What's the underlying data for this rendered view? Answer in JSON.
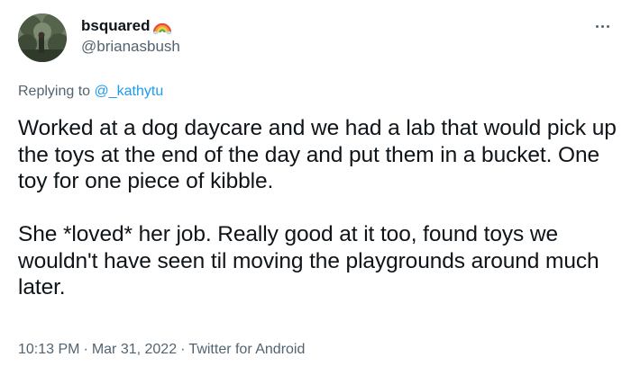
{
  "author": {
    "display_name": "bsquared",
    "handle": "@brianasbush",
    "name_emoji_icon": "rainbow-icon"
  },
  "more_icon": "more-horizontal-icon",
  "reply": {
    "prefix": "Replying to",
    "target": "@_kathytu"
  },
  "tweet": {
    "text": "Worked at a dog daycare and we had a lab that would pick up the toys at the end of the day and put them in a bucket. One toy for one piece of kibble.\n\nShe *loved* her job. Really good at it too, found toys we wouldn't have seen til moving the playgrounds around much later."
  },
  "meta": {
    "time": "10:13 PM",
    "separator": "·",
    "date": "Mar 31, 2022",
    "source": "Twitter for Android"
  },
  "colors": {
    "text": "#0f1419",
    "secondary": "#536471",
    "link": "#1d9bf0",
    "background": "#ffffff"
  }
}
